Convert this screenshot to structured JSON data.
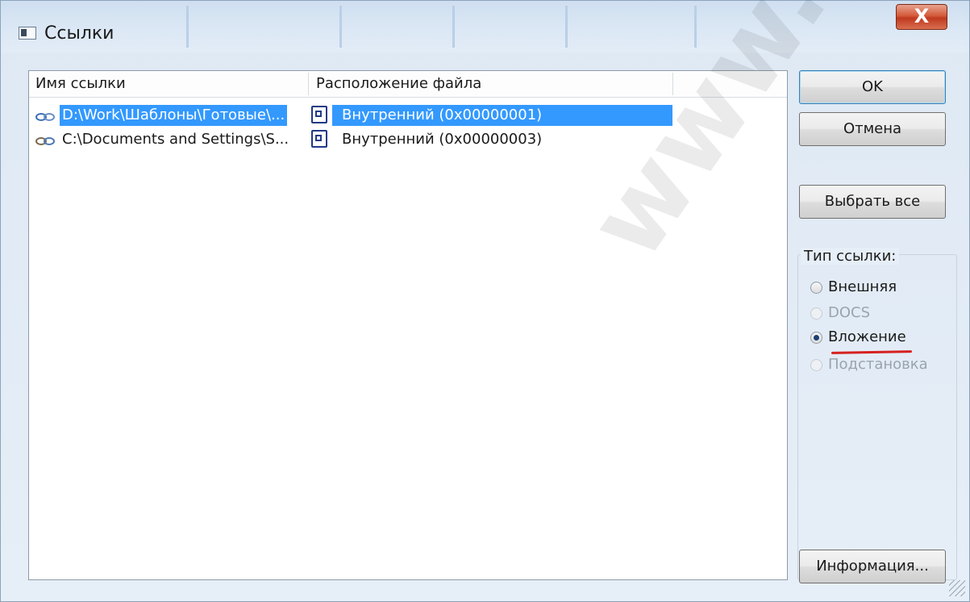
{
  "window": {
    "title": "Ссылки",
    "close_label": "X"
  },
  "list": {
    "columns": [
      "Имя ссылки",
      "Расположение файла"
    ],
    "rows": [
      {
        "name": "D:\\Work\\Шаблоны\\Готовые\\...",
        "location": "Внутренний (0x00000001)",
        "selected": true
      },
      {
        "name": "C:\\Documents and Settings\\S...",
        "location": "Внутренний (0x00000003)",
        "selected": false
      }
    ]
  },
  "buttons": {
    "ok": "OK",
    "cancel": "Отмена",
    "select_all": "Выбрать все",
    "info": "Информация..."
  },
  "link_type": {
    "label": "Тип ссылки:",
    "options": [
      {
        "label": "Внешняя",
        "checked": false,
        "disabled": false
      },
      {
        "label": "DOCS",
        "checked": false,
        "disabled": true
      },
      {
        "label": "Вложение",
        "checked": true,
        "disabled": false
      },
      {
        "label": "Подстановка",
        "checked": false,
        "disabled": true
      }
    ]
  },
  "watermark": "www.n.ch"
}
